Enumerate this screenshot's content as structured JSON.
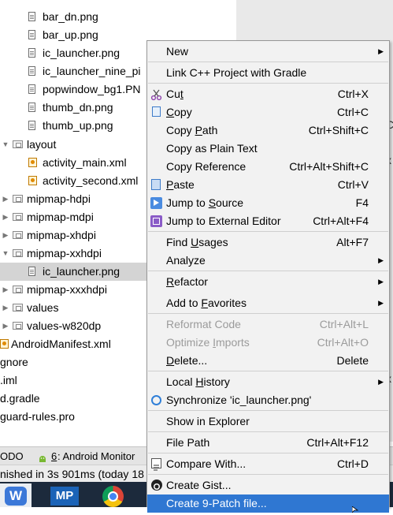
{
  "tree": {
    "items": [
      {
        "label": "bar_dn.png",
        "kind": "file"
      },
      {
        "label": "bar_up.png",
        "kind": "file"
      },
      {
        "label": "ic_launcher.png",
        "kind": "file"
      },
      {
        "label": "ic_launcher_nine_pi",
        "kind": "file"
      },
      {
        "label": "popwindow_bg1.PN",
        "kind": "file"
      },
      {
        "label": "thumb_dn.png",
        "kind": "file"
      },
      {
        "label": "thumb_up.png",
        "kind": "file"
      },
      {
        "label": "layout",
        "kind": "folder-open"
      },
      {
        "label": "activity_main.xml",
        "kind": "xml"
      },
      {
        "label": "activity_second.xml",
        "kind": "xml"
      },
      {
        "label": "mipmap-hdpi",
        "kind": "folder"
      },
      {
        "label": "mipmap-mdpi",
        "kind": "folder"
      },
      {
        "label": "mipmap-xhdpi",
        "kind": "folder"
      },
      {
        "label": "mipmap-xxhdpi",
        "kind": "folder-open"
      },
      {
        "label": "ic_launcher.png",
        "kind": "file",
        "selected": true
      },
      {
        "label": "mipmap-xxxhdpi",
        "kind": "folder"
      },
      {
        "label": "values",
        "kind": "folder"
      },
      {
        "label": "values-w820dp",
        "kind": "folder"
      },
      {
        "label": "AndroidManifest.xml",
        "kind": "xml"
      },
      {
        "label": "gnore",
        "kind": "text"
      },
      {
        "label": ".iml",
        "kind": "text"
      },
      {
        "label": "d.gradle",
        "kind": "text"
      },
      {
        "label": "guard-rules.pro",
        "kind": "text"
      }
    ]
  },
  "toolstrip": {
    "todo_label": "ODO",
    "android_monitor_number": "6",
    "android_monitor_label": ": Android Monitor"
  },
  "statusbar": {
    "text": "nished in 3s 901ms (today 18"
  },
  "taskbar": {
    "app1_label": "W",
    "app2_label": "MP"
  },
  "context_menu": {
    "items": [
      {
        "label": "New",
        "shortcut": "",
        "submenu": true
      },
      {
        "label": "Link C++ Project with Gradle",
        "shortcut": ""
      },
      {
        "label": "Cut",
        "shortcut": "Ctrl+X",
        "icon": "scissors-icon"
      },
      {
        "label": "Copy",
        "shortcut": "Ctrl+C",
        "icon": "copy-icon"
      },
      {
        "label": "Copy Path",
        "shortcut": "Ctrl+Shift+C"
      },
      {
        "label": "Copy as Plain Text",
        "shortcut": ""
      },
      {
        "label": "Copy Reference",
        "shortcut": "Ctrl+Alt+Shift+C"
      },
      {
        "label": "Paste",
        "shortcut": "Ctrl+V",
        "icon": "paste-icon"
      },
      {
        "label": "Jump to Source",
        "shortcut": "F4",
        "icon": "jump-to-source-icon"
      },
      {
        "label": "Jump to External Editor",
        "shortcut": "Ctrl+Alt+F4",
        "icon": "external-editor-icon"
      },
      {
        "label": "Find Usages",
        "shortcut": "Alt+F7"
      },
      {
        "label": "Analyze",
        "shortcut": "",
        "submenu": true
      },
      {
        "label": "Refactor",
        "shortcut": "",
        "submenu": true
      },
      {
        "label": "Add to Favorites",
        "shortcut": "",
        "submenu": true
      },
      {
        "label": "Reformat Code",
        "shortcut": "Ctrl+Alt+L",
        "disabled": true
      },
      {
        "label": "Optimize Imports",
        "shortcut": "Ctrl+Alt+O",
        "disabled": true
      },
      {
        "label": "Delete...",
        "shortcut": "Delete"
      },
      {
        "label": "Local History",
        "shortcut": "",
        "submenu": true
      },
      {
        "label": "Synchronize 'ic_launcher.png'",
        "shortcut": "",
        "icon": "sync-icon"
      },
      {
        "label": "Show in Explorer",
        "shortcut": ""
      },
      {
        "label": "File Path",
        "shortcut": "Ctrl+Alt+F12"
      },
      {
        "label": "Compare With...",
        "shortcut": "Ctrl+D",
        "icon": "compare-icon"
      },
      {
        "label": "Create Gist...",
        "shortcut": "",
        "icon": "gist-icon"
      },
      {
        "label": "Create 9-Patch file...",
        "shortcut": "",
        "highlighted": true
      }
    ]
  },
  "colors": {
    "menu_highlight": "#2f77d2",
    "selection": "#d4d4d4",
    "taskbar": "#1c2a3c"
  }
}
